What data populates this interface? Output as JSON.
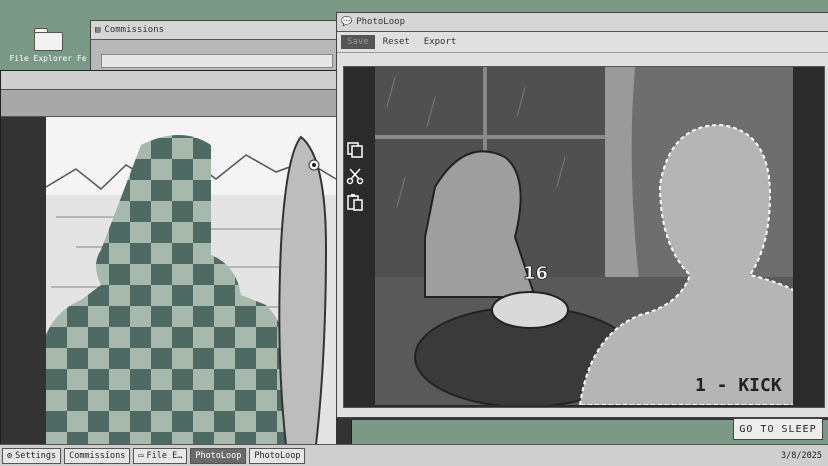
{
  "desktop": {
    "icon_label": "File Explorer Fe"
  },
  "windows": {
    "commissions": {
      "title": "Commissions"
    },
    "photoloop": {
      "title": "PhotoLoop",
      "menu": [
        "Save",
        "Reset",
        "Export"
      ]
    }
  },
  "photo": {
    "cake_number": "16",
    "shirt_text": "1 - KICK"
  },
  "go_to_sleep": "GO TO SLEEP",
  "taskbar": {
    "items": [
      "Settings",
      "Commissions",
      "File E…",
      "PhotoLoop",
      "PhotoLoop"
    ],
    "clock": "3/8/2025"
  }
}
